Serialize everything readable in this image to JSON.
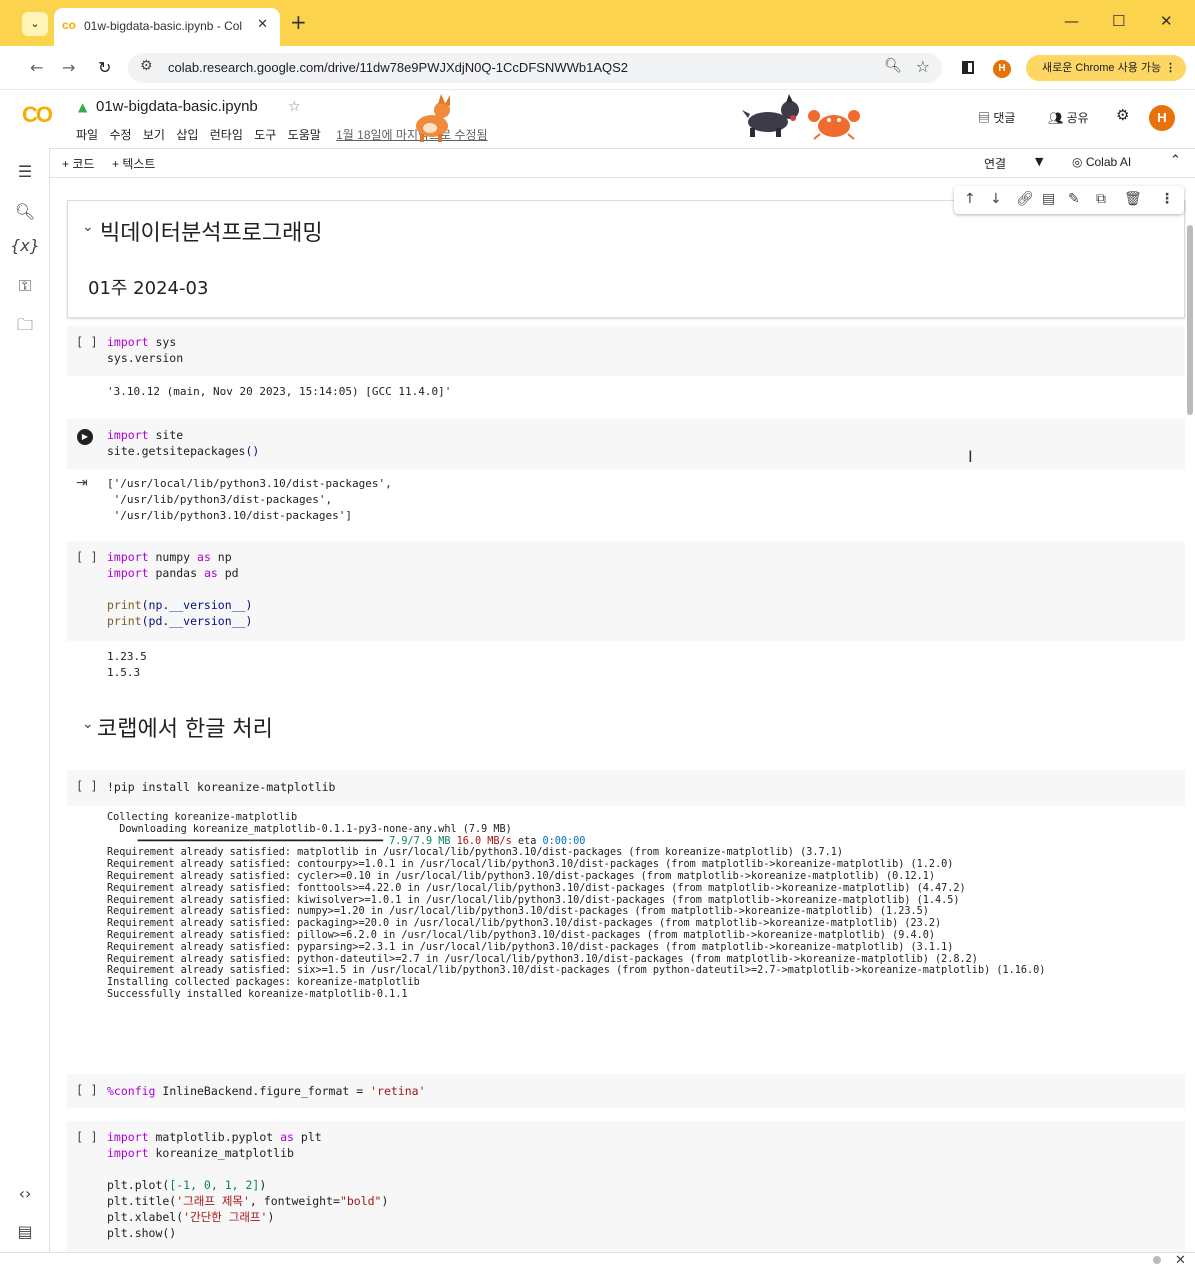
{
  "browser": {
    "tab_title": "01w-bigdata-basic.ipynb - Col",
    "favicon": "co",
    "url": "colab.research.google.com/drive/11dw78e9PWJXdjN0Q-1CcDFSNWWb1AQS2",
    "profile_initial": "H",
    "chrome_update_label": "새로운 Chrome 사용 가능",
    "colors": {
      "tabstrip": "#fbd34d",
      "accent": "#f9ab00"
    }
  },
  "colab": {
    "logo": "CO",
    "notebook_title": "01w-bigdata-basic.ipynb",
    "menu": [
      "파일",
      "수정",
      "보기",
      "삽입",
      "런타임",
      "도구",
      "도움말"
    ],
    "last_edit": "1월 18일에 마지막으로 수정됨",
    "comment_label": "댓글",
    "share_label": "공유",
    "avatar_initial": "H",
    "add_code": "+ 코드",
    "add_text": "+ 텍스트",
    "connect_label": "연결",
    "colab_ai_label": "Colab AI"
  },
  "cells": {
    "title": {
      "heading": "빅데이터분석프로그래밍",
      "subheading": "01주 2024-03"
    },
    "c1": {
      "bracket": "[ ]",
      "code_line1_kw": "import",
      "code_line1_rest": " sys",
      "code_line2": "sys.version",
      "output": "'3.10.12 (main, Nov 20 2023, 15:14:05) [GCC 11.4.0]'"
    },
    "c2": {
      "code_line1_kw": "import",
      "code_line1_rest": " site",
      "code_line2_a": "site.getsitepackages",
      "code_line2_b": "()",
      "output": "['/usr/local/lib/python3.10/dist-packages',\n '/usr/lib/python3/dist-packages',\n '/usr/lib/python3.10/dist-packages']"
    },
    "c3": {
      "bracket": "[ ]",
      "l1_kw": "import",
      "l1_mid": " numpy ",
      "l1_kw2": "as",
      "l1_rest": " np",
      "l2_kw": "import",
      "l2_mid": " pandas ",
      "l2_kw2": "as",
      "l2_rest": " pd",
      "l4_fn": "print",
      "l4_rest": "(np.__version__)",
      "l5_fn": "print",
      "l5_rest": "(pd.__version__)",
      "output": "1.23.5\n1.5.3"
    },
    "section2": {
      "heading": "코랩에서 한글 처리"
    },
    "c4": {
      "bracket": "[ ]",
      "code": "!pip install koreanize-matplotlib",
      "output_head": "Collecting koreanize-matplotlib\n  Downloading koreanize_matplotlib-0.1.1-py3-none-any.whl (7.9 MB)",
      "progress_bar": "     ━━━━━━━━━━━━━━━━━━━━━━━━━━━━━━━━━━━━━━━━",
      "progress_size": " 7.9/7.9 MB",
      "progress_speed": " 16.0 MB/s",
      "progress_eta_label": " eta ",
      "progress_eta": "0:00:00",
      "progress_fraction": 1.0,
      "output_body": "Requirement already satisfied: matplotlib in /usr/local/lib/python3.10/dist-packages (from koreanize-matplotlib) (3.7.1)\nRequirement already satisfied: contourpy>=1.0.1 in /usr/local/lib/python3.10/dist-packages (from matplotlib->koreanize-matplotlib) (1.2.0)\nRequirement already satisfied: cycler>=0.10 in /usr/local/lib/python3.10/dist-packages (from matplotlib->koreanize-matplotlib) (0.12.1)\nRequirement already satisfied: fonttools>=4.22.0 in /usr/local/lib/python3.10/dist-packages (from matplotlib->koreanize-matplotlib) (4.47.2)\nRequirement already satisfied: kiwisolver>=1.0.1 in /usr/local/lib/python3.10/dist-packages (from matplotlib->koreanize-matplotlib) (1.4.5)\nRequirement already satisfied: numpy>=1.20 in /usr/local/lib/python3.10/dist-packages (from matplotlib->koreanize-matplotlib) (1.23.5)\nRequirement already satisfied: packaging>=20.0 in /usr/local/lib/python3.10/dist-packages (from matplotlib->koreanize-matplotlib) (23.2)\nRequirement already satisfied: pillow>=6.2.0 in /usr/local/lib/python3.10/dist-packages (from matplotlib->koreanize-matplotlib) (9.4.0)\nRequirement already satisfied: pyparsing>=2.3.1 in /usr/local/lib/python3.10/dist-packages (from matplotlib->koreanize-matplotlib) (3.1.1)\nRequirement already satisfied: python-dateutil>=2.7 in /usr/local/lib/python3.10/dist-packages (from matplotlib->koreanize-matplotlib) (2.8.2)\nRequirement already satisfied: six>=1.5 in /usr/local/lib/python3.10/dist-packages (from python-dateutil>=2.7->matplotlib->koreanize-matplotlib) (1.16.0)\nInstalling collected packages: koreanize-matplotlib\nSuccessfully installed koreanize-matplotlib-0.1.1"
    },
    "c5": {
      "bracket": "[ ]",
      "kw": "%config",
      "mid": " InlineBackend.figure_format = ",
      "str": "'retina'"
    },
    "c6": {
      "bracket": "[ ]",
      "l1_kw": "import",
      "l1_mid": " matplotlib.pyplot ",
      "l1_kw2": "as",
      "l1_rest": " plt",
      "l2_kw": "import",
      "l2_rest": " koreanize_matplotlib",
      "l4_a": "plt.plot(",
      "l4_num": "[-1, 0, 1, 2]",
      "l4_b": ")",
      "l5_a": "plt.title(",
      "l5_str": "'그래프 제목'",
      "l5_b": ", fontweight=",
      "l5_str2": "\"bold\"",
      "l5_c": ")",
      "l6_a": "plt.xlabel(",
      "l6_str": "'간단한 그래프'",
      "l6_b": ")",
      "l7": "plt.show()"
    }
  }
}
